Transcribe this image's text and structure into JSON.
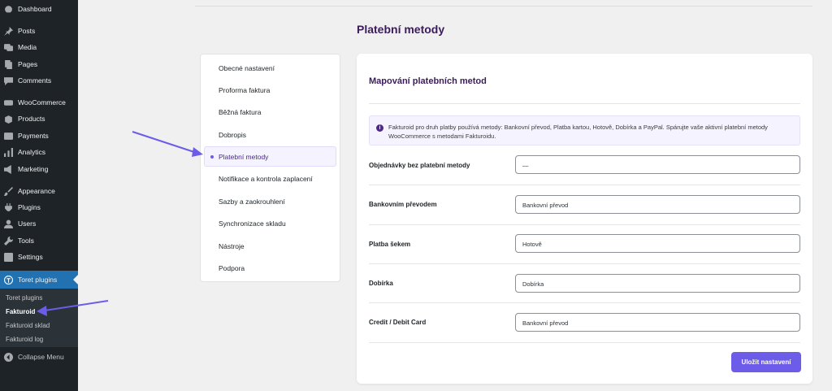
{
  "admin_menu": {
    "items": [
      {
        "label": "Dashboard",
        "icon": "dashboard-icon"
      },
      {
        "label": "Posts",
        "icon": "pin-icon"
      },
      {
        "label": "Media",
        "icon": "media-icon"
      },
      {
        "label": "Pages",
        "icon": "pages-icon"
      },
      {
        "label": "Comments",
        "icon": "comments-icon"
      },
      {
        "label": "WooCommerce",
        "icon": "woocommerce-icon"
      },
      {
        "label": "Products",
        "icon": "products-icon"
      },
      {
        "label": "Payments",
        "icon": "payments-icon"
      },
      {
        "label": "Analytics",
        "icon": "analytics-icon"
      },
      {
        "label": "Marketing",
        "icon": "marketing-icon"
      },
      {
        "label": "Appearance",
        "icon": "appearance-icon"
      },
      {
        "label": "Plugins",
        "icon": "plugins-icon"
      },
      {
        "label": "Users",
        "icon": "users-icon"
      },
      {
        "label": "Tools",
        "icon": "tools-icon"
      },
      {
        "label": "Settings",
        "icon": "settings-icon"
      },
      {
        "label": "Toret plugins",
        "icon": "toret-icon"
      }
    ],
    "submenu": [
      "Toret plugins",
      "Fakturoid",
      "Fakturoid sklad",
      "Fakturoid log"
    ],
    "collapse": "Collapse Menu"
  },
  "page": {
    "title": "Platební metody"
  },
  "settings_nav": {
    "items": [
      "Obecné nastavení",
      "Proforma faktura",
      "Běžná faktura",
      "Dobropis",
      "Platební metody",
      "Notifikace a kontrola zaplacení",
      "Sazby a zaokrouhlení",
      "Synchronizace skladu",
      "Nástroje",
      "Podpora"
    ]
  },
  "mapping": {
    "title": "Mapování platebních metod",
    "notice": "Fakturoid pro druh platby používá metody: Bankovní převod, Platba kartou, Hotově, Dobírka a PayPal. Spárujte vaše aktivní platební metody WooCommerce s metodami Fakturoidu.",
    "rows": [
      {
        "label": "Objednávky bez platební metody",
        "value": "—"
      },
      {
        "label": "Bankovním převodem",
        "value": "Bankovní převod"
      },
      {
        "label": "Platba šekem",
        "value": "Hotově"
      },
      {
        "label": "Dobírka",
        "value": "Dobírka"
      },
      {
        "label": "Credit / Debit Card",
        "value": "Bankovní převod"
      }
    ],
    "save_label": "Uložit nastavení"
  },
  "colors": {
    "accent": "#6c5ce7",
    "heading": "#3b1c5a",
    "sidebar": "#1d2327",
    "active_menu": "#2271b1"
  }
}
